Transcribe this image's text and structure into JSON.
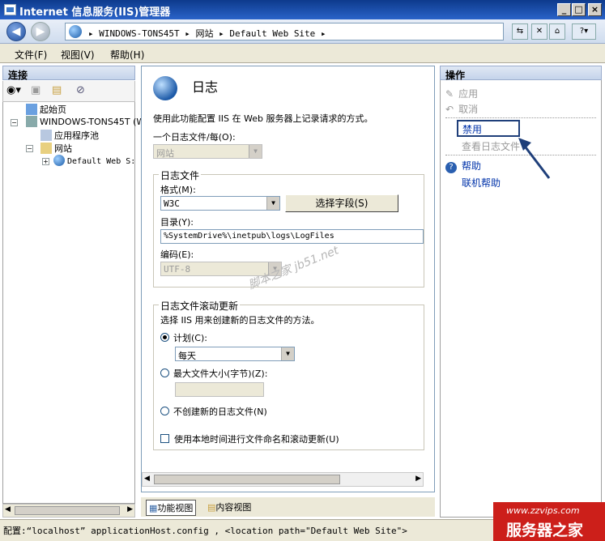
{
  "window": {
    "title": "Internet 信息服务(IIS)管理器",
    "min": "_",
    "max": "□",
    "close": "×"
  },
  "nav": {
    "breadcrumbs": [
      "WINDOWS-TONS45T",
      "网站",
      "Default Web Site"
    ],
    "sep": "▸"
  },
  "menu": [
    "文件(F)",
    "视图(V)",
    "帮助(H)"
  ],
  "connections": {
    "header": "连接",
    "tree": [
      {
        "label": "起始页"
      },
      {
        "label": "WINDOWS-TONS45T (WIN"
      },
      {
        "label": "应用程序池"
      },
      {
        "label": "网站"
      },
      {
        "label": "Default Web S:"
      }
    ]
  },
  "feature": {
    "title": "日志",
    "description": "使用此功能配置 IIS 在 Web 服务器上记录请求的方式。",
    "one_file_label": "一个日志文件/每(O):",
    "one_file_value": "网站",
    "logfile": {
      "legend": "日志文件",
      "format_label": "格式(M):",
      "format_value": "W3C",
      "select_fields_button": "选择字段(S)",
      "directory_label": "目录(Y):",
      "directory_value": "%SystemDrive%\\inetpub\\logs\\LogFiles",
      "encoding_label": "编码(E):",
      "encoding_value": "UTF-8"
    },
    "rollover": {
      "legend": "日志文件滚动更新",
      "description": "选择 IIS 用来创建新的日志文件的方法。",
      "schedule_label": "计划(C):",
      "schedule_value": "每天",
      "maxsize_label": "最大文件大小(字节)(Z):",
      "no_new_label": "不创建新的日志文件(N)",
      "local_time_label": "使用本地时间进行文件命名和滚动更新(U)"
    }
  },
  "watermark": "脚本之家 jb51.net",
  "view_tabs": [
    "功能视图",
    "内容视图"
  ],
  "actions": {
    "header": "操作",
    "apply": "应用",
    "cancel": "取消",
    "disable": "禁用",
    "view_log": "查看日志文件",
    "help": "帮助",
    "online_help": "联机帮助"
  },
  "status": "配置:“localhost” applicationHost.config , <location path=\"Default Web Site\">",
  "logo": {
    "url": "www.zzvips.com",
    "name": "服务器之家"
  },
  "colors": {
    "titlebar": "#0d3a8c",
    "link": "#0033aa",
    "highlight_border": "#1f3f7a",
    "logo_bg": "#cc1f1a"
  }
}
